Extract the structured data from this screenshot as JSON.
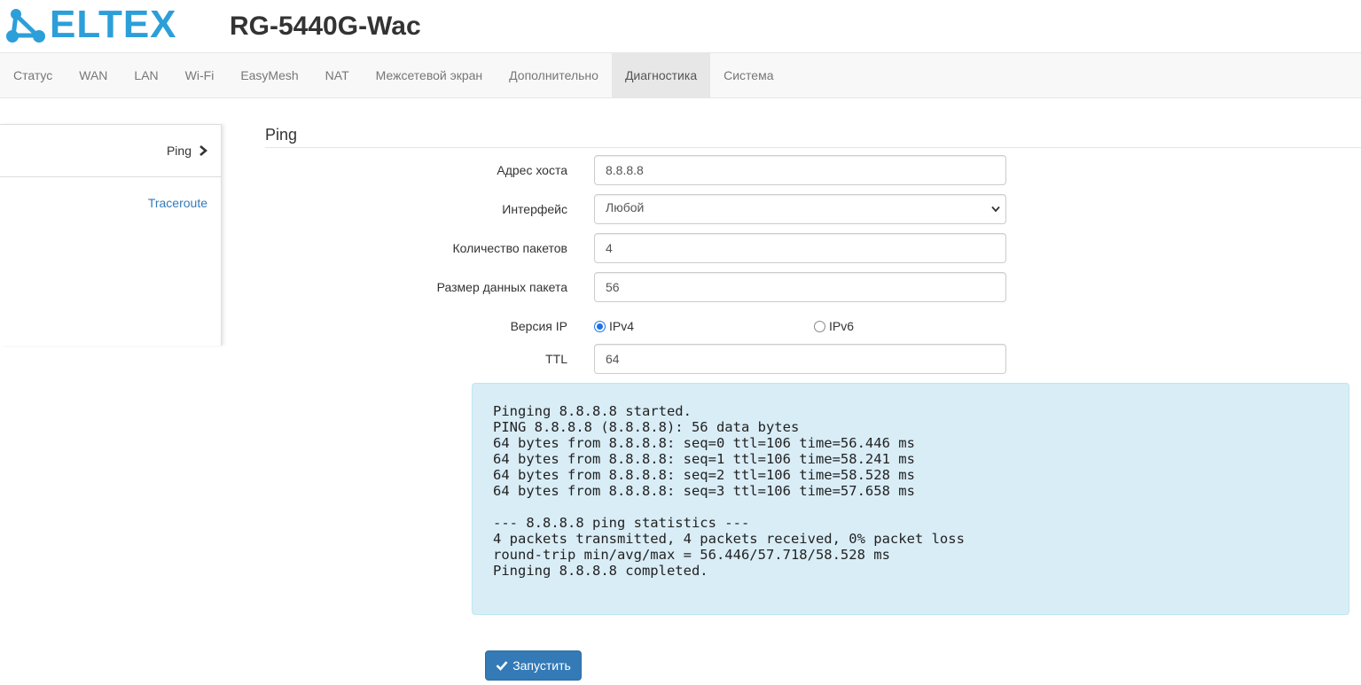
{
  "header": {
    "logo_text": "ELTEX",
    "model": "RG-5440G-Wac",
    "brand_color": "#2c9fd9"
  },
  "nav": {
    "items": [
      {
        "label": "Статус"
      },
      {
        "label": "WAN"
      },
      {
        "label": "LAN"
      },
      {
        "label": "Wi-Fi"
      },
      {
        "label": "EasyMesh"
      },
      {
        "label": "NAT"
      },
      {
        "label": "Межсетевой экран"
      },
      {
        "label": "Дополнительно"
      },
      {
        "label": "Диагностика",
        "active": true
      },
      {
        "label": "Система"
      }
    ]
  },
  "sidebar": {
    "items": [
      {
        "label": "Ping",
        "active": true,
        "icon": "chevron-right-icon"
      },
      {
        "label": "Traceroute"
      }
    ]
  },
  "ping": {
    "section_title": "Ping",
    "host_label": "Адрес хоста",
    "host_value": "8.8.8.8",
    "interface_label": "Интерфейс",
    "interface_value": "Любой",
    "count_label": "Количество пакетов",
    "count_value": "4",
    "size_label": "Размер данных пакета",
    "size_value": "56",
    "ip_version_label": "Версия IP",
    "ipv4_label": "IPv4",
    "ipv6_label": "IPv6",
    "ip_version_selected": "IPv4",
    "ttl_label": "TTL",
    "ttl_value": "64",
    "output": "Pinging 8.8.8.8 started.\nPING 8.8.8.8 (8.8.8.8): 56 data bytes\n64 bytes from 8.8.8.8: seq=0 ttl=106 time=56.446 ms\n64 bytes from 8.8.8.8: seq=1 ttl=106 time=58.241 ms\n64 bytes from 8.8.8.8: seq=2 ttl=106 time=58.528 ms\n64 bytes from 8.8.8.8: seq=3 ttl=106 time=57.658 ms\n\n--- 8.8.8.8 ping statistics ---\n4 packets transmitted, 4 packets received, 0% packet loss\nround-trip min/avg/max = 56.446/57.718/58.528 ms\nPinging 8.8.8.8 completed.",
    "run_label": "Запустить",
    "run_icon": "check-icon"
  }
}
